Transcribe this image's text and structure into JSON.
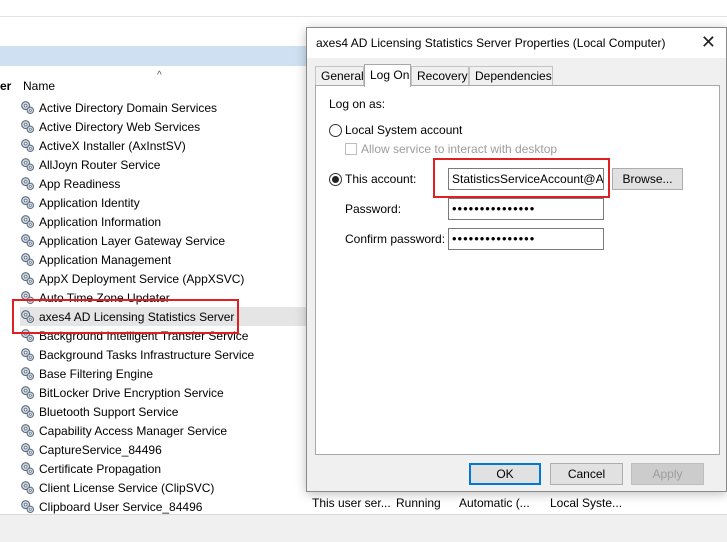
{
  "background": {
    "column_fragment": "er",
    "column_name": "Name",
    "services": [
      "Active Directory Domain Services",
      "Active Directory Web Services",
      "ActiveX Installer (AxInstSV)",
      "AllJoyn Router Service",
      "App Readiness",
      "Application Identity",
      "Application Information",
      "Application Layer Gateway Service",
      "Application Management",
      "AppX Deployment Service (AppXSVC)",
      "Auto Time Zone Updater",
      "axes4 AD Licensing Statistics Server",
      "Background Intelligent Transfer Service",
      "Background Tasks Infrastructure Service",
      "Base Filtering Engine",
      "BitLocker Drive Encryption Service",
      "Bluetooth Support Service",
      "Capability Access Manager Service",
      "CaptureService_84496",
      "Certificate Propagation",
      "Client License Service (ClipSVC)",
      "Clipboard User Service_84496"
    ],
    "selected_index": 11,
    "last_row_details": {
      "description": "This user ser...",
      "status": "Running",
      "startup": "Automatic (...",
      "logon": "Local Syste..."
    }
  },
  "dialog": {
    "title": "axes4 AD Licensing Statistics Server Properties (Local Computer)",
    "close_glyph": "✕",
    "tabs": [
      "General",
      "Log On",
      "Recovery",
      "Dependencies"
    ],
    "active_tab": "Log On",
    "logon_as_label": "Log on as:",
    "local_system_label": "Local System account",
    "allow_desktop_label": "Allow service to interact with desktop",
    "this_account_label": "This account:",
    "account_value": "StatisticsServiceAccount@ADL",
    "browse_label": "Browse...",
    "password_label": "Password:",
    "password_value": "•••••••••••••••",
    "confirm_label": "Confirm password:",
    "confirm_value": "•••••••••••••••",
    "ok_label": "OK",
    "cancel_label": "Cancel",
    "apply_label": "Apply"
  },
  "colors": {
    "highlight": "#e02020",
    "selection_bar": "#cfe0f3",
    "default_button_border": "#0078d7"
  }
}
